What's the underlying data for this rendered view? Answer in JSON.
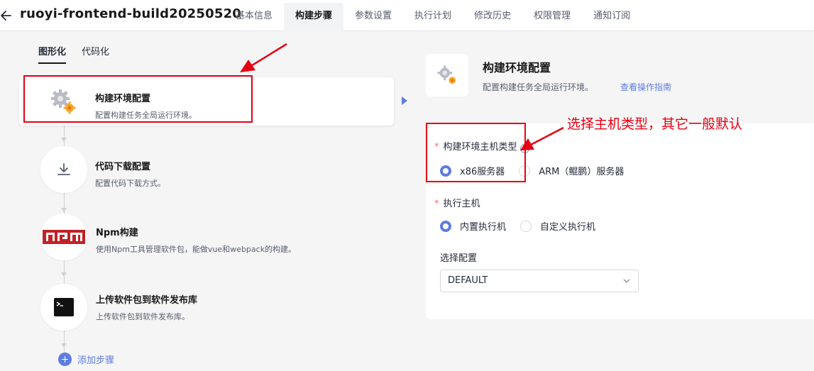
{
  "header": {
    "title": "ruoyi-frontend-build20250520",
    "tabs": [
      {
        "label": "基本信息"
      },
      {
        "label": "构建步骤"
      },
      {
        "label": "参数设置"
      },
      {
        "label": "执行计划"
      },
      {
        "label": "修改历史"
      },
      {
        "label": "权限管理"
      },
      {
        "label": "通知订阅"
      }
    ],
    "active_tab": "构建步骤"
  },
  "mode_tabs": [
    {
      "label": "图形化"
    },
    {
      "label": "代码化"
    }
  ],
  "steps": [
    {
      "name": "构建环境配置",
      "desc": "配置构建任务全局运行环境。",
      "icon": "gear-icon"
    },
    {
      "name": "代码下载配置",
      "desc": "配置代码下载方式。",
      "icon": "download-icon"
    },
    {
      "name": "Npm构建",
      "desc": "使用Npm工具管理软件包，能做vue和webpack的构建。",
      "icon": "npm-logo-icon"
    },
    {
      "name": "上传软件包到软件发布库",
      "desc": "上传软件包到软件发布库。",
      "icon": "terminal-icon"
    }
  ],
  "add_step_label": "添加步骤",
  "config": {
    "title": "构建环境配置",
    "desc": "配置构建任务全局运行环境。",
    "guide_link": "查看操作指南",
    "host_type": {
      "label": "构建环境主机类型",
      "options": [
        "x86服务器",
        "ARM（鲲鹏）服务器"
      ],
      "selected": "x86服务器"
    },
    "executor": {
      "label": "执行主机",
      "options": [
        "内置执行机",
        "自定义执行机"
      ],
      "selected": "内置执行机"
    },
    "profile": {
      "label": "选择配置",
      "value": "DEFAULT"
    }
  },
  "annotation": {
    "text": "选择主机类型，其它一般默认",
    "color": "#e60012"
  },
  "colors": {
    "accent": "#5e7ce0",
    "required": "#f66f6a"
  }
}
